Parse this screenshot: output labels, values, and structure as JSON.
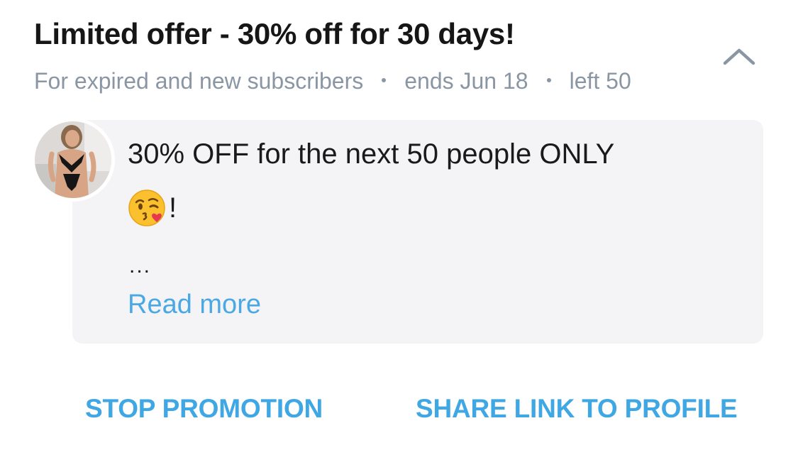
{
  "offer": {
    "title": "Limited offer - 30% off for 30 days!",
    "audience": "For expired and new subscribers",
    "ends": "ends Jun 18",
    "left": "left 50"
  },
  "message": {
    "line1": "30% OFF for the next 50 people ONLY",
    "emoji_name": "face-blowing-kiss-icon",
    "line2_suffix": "!",
    "ellipsis": "...",
    "read_more": "Read more"
  },
  "actions": {
    "stop_label": "STOP PROMOTION",
    "share_label": "SHARE LINK TO PROFILE"
  },
  "colors": {
    "accent": "#3ea7e4",
    "muted_text": "#8a96a3",
    "card_background": "#f4f4f6",
    "title_text": "#161616"
  }
}
